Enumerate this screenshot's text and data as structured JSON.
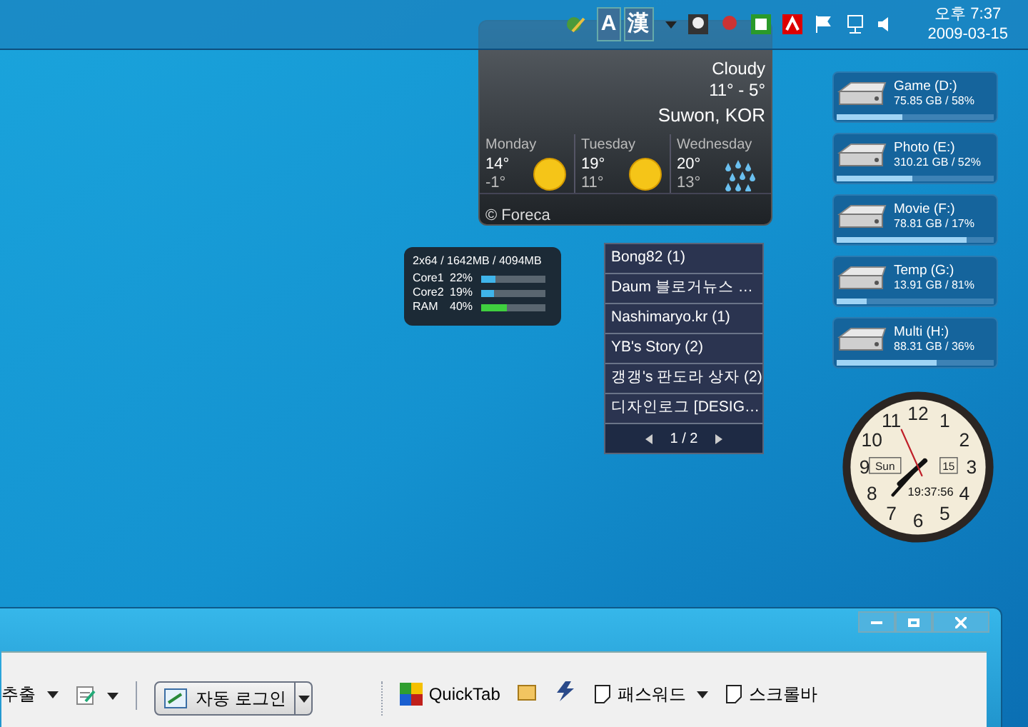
{
  "taskbar": {
    "ime": [
      "A",
      "漢"
    ],
    "time": "오후 7:37",
    "date": "2009-03-15"
  },
  "weather": {
    "condition": "Cloudy",
    "range": "11° - 5°",
    "city": "Suwon, KOR",
    "credit": "© Foreca",
    "days": [
      {
        "name": "Monday",
        "high": "14°",
        "low": "-1°",
        "kind": "sun"
      },
      {
        "name": "Tuesday",
        "high": "19°",
        "low": "11°",
        "kind": "sun"
      },
      {
        "name": "Wednesday",
        "high": "20°",
        "low": "13°",
        "kind": "rain"
      }
    ]
  },
  "cpu_meter": {
    "header": "2x64 / 1642MB / 4094MB",
    "rows": [
      {
        "label": "Core1",
        "reading": "22%",
        "level": 0.22,
        "kind": "cpu"
      },
      {
        "label": "Core2",
        "reading": "19%",
        "level": 0.19,
        "kind": "cpu"
      },
      {
        "label": "RAM",
        "reading": "40%",
        "level": 0.4,
        "kind": "ram"
      }
    ]
  },
  "feeds": {
    "items": [
      "Bong82 (1)",
      "Daum 블로거뉴스 …",
      "Nashimaryo.kr (1)",
      "YB's Story (2)",
      "갱갱's 판도라 상자 (2)",
      "디자인로그 [DESIG…"
    ],
    "pager": "1 / 2"
  },
  "drives": [
    {
      "name": "Game (D:)",
      "info": "75.85 GB / 58%",
      "level": 0.42
    },
    {
      "name": "Photo (E:)",
      "info": "310.21 GB / 52%",
      "level": 0.48
    },
    {
      "name": "Movie (F:)",
      "info": "78.81 GB / 17%",
      "level": 0.83
    },
    {
      "name": "Temp (G:)",
      "info": "13.91 GB / 81%",
      "level": 0.19
    },
    {
      "name": "Multi (H:)",
      "info": "88.31 GB / 36%",
      "level": 0.64
    }
  ],
  "clock": {
    "numerals": [
      "12",
      "11",
      "1",
      "10",
      "2",
      "9",
      "3",
      "8",
      "4",
      "7",
      "5",
      "6"
    ],
    "day": "Sun",
    "date": "15",
    "digital": "19:37:56"
  },
  "window": {
    "toolbar": [
      {
        "kind": "dropdown-text",
        "label": "추출"
      },
      {
        "kind": "dropdown-icon"
      },
      {
        "kind": "split",
        "label": "자동 로그인"
      },
      {
        "kind": "quicktab",
        "label": "QuickTab"
      },
      {
        "kind": "icon"
      },
      {
        "kind": "icon2"
      },
      {
        "kind": "dropdown-note",
        "label": "패스워드"
      },
      {
        "kind": "note",
        "label": "스크롤바"
      }
    ]
  }
}
